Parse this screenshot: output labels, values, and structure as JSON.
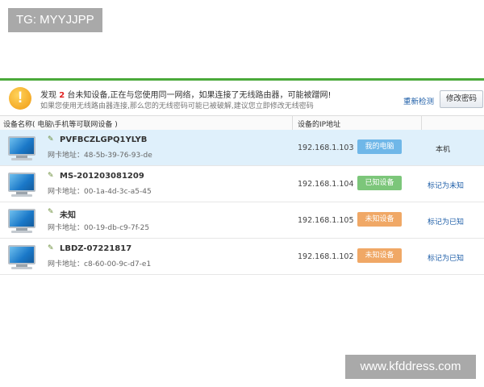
{
  "watermarks": {
    "top": "TG: MYYJJPP",
    "bottom": "www.kfddress.com"
  },
  "alert": {
    "icon": "exclamation-icon",
    "prefix": "发现",
    "count": "2",
    "suffix": "台未知设备,正在与您使用同一网络，如果连接了无线路由器，可能被蹭网!",
    "sub": "如果您使用无线路由器连接,那么您的无线密码可能已被破解,建议您立即修改无线密码"
  },
  "buttons": {
    "rescan": "重新检测",
    "change_password": "修改密码"
  },
  "table": {
    "col_device": "设备名称( 电脑\\手机等可联网设备 )",
    "col_ip": "设备的IP地址",
    "rows": [
      {
        "name": "PVFBCZLGPQ1YLYB",
        "mac": "网卡地址：48-5b-39-76-93-de",
        "ip": "192.168.1.103",
        "status": "我的电脑",
        "action": "本机"
      },
      {
        "name": "MS-201203081209",
        "mac": "网卡地址：00-1a-4d-3c-a5-45",
        "ip": "192.168.1.104",
        "status": "已知设备",
        "action": "标记为未知"
      },
      {
        "name": "未知",
        "mac": "网卡地址：00-19-db-c9-7f-25",
        "ip": "192.168.1.105",
        "status": "未知设备",
        "action": "标记为已知"
      },
      {
        "name": "LBDZ-07221817",
        "mac": "网卡地址：c8-60-00-9c-d7-e1",
        "ip": "192.168.1.102",
        "status": "未知设备",
        "action": "标记为已知"
      }
    ]
  },
  "colors": {
    "accent_green": "#4aa93a",
    "selected_row": "#dff0fb",
    "badge_blue": "#6fb7e8",
    "badge_green": "#7cc67a",
    "badge_orange": "#f0a866",
    "link": "#1f5fa8",
    "count_red": "#e02020"
  }
}
